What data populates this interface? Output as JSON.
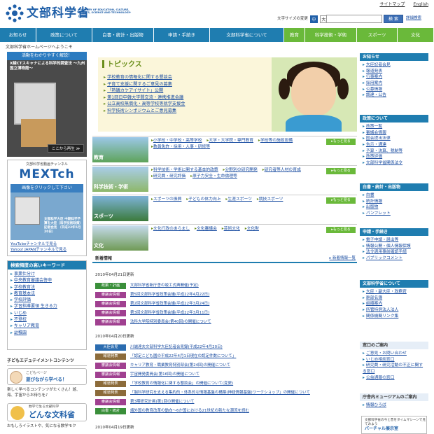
{
  "header": {
    "logo_text": "文部科学省",
    "logo_en": "MINISTRY OF EDUCATION, CULTURE, SPORTS, SCIENCE AND TECHNOLOGY-JAPAN",
    "top_links": [
      "サイトマップ",
      "English"
    ],
    "font_size_label": "文字サイズの変更",
    "font_size_options": [
      "中",
      "大"
    ],
    "search_placeholder": "",
    "search_button": "検 索",
    "advanced_search": "詳細検索"
  },
  "nav": {
    "items": [
      {
        "label": "お知らせ",
        "color": "#1f7db0"
      },
      {
        "label": "政策について",
        "color": "#1f7db0"
      },
      {
        "label": "白書・統計・出版物",
        "color": "#1f7db0"
      },
      {
        "label": "申請・手続き",
        "color": "#1f7db0"
      },
      {
        "label": "文部科学省について",
        "color": "#1f7db0"
      },
      {
        "label": "教育",
        "color": "#6ab93a"
      },
      {
        "label": "科学技術・学術",
        "color": "#6ab93a"
      },
      {
        "label": "スポーツ",
        "color": "#6ab93a"
      },
      {
        "label": "文化",
        "color": "#6ab93a"
      }
    ]
  },
  "breadcrumb": "文部科学省ホームページへようこそ",
  "banner1": {
    "caption": "活動をわかりやすく解説！",
    "title": "X線CTスキャナによる科学的調査法 〜九州国立博物館〜",
    "more": "ここから再生 ≫"
  },
  "mext": {
    "label": "文部科学省動画チャンネル",
    "logo": "MEXTch",
    "image_bar": "画像をクリックして下さい",
    "image_text": "文部科学大臣 中期科学予算を大臣（科学技術政策）記者会見 （平成22年5月20日）",
    "links": [
      "YouTubeチャンネルで見る",
      "Yahoo! JAPANチャンネルで見る"
    ]
  },
  "keywords": {
    "title": "検索頻度の高いキーワード",
    "items": [
      "事業仕分け",
      "中央教育審議会答申",
      "学校教育法",
      "教育基本法",
      "学校評価",
      "学習指導要領 生きる力",
      "いじめ",
      "不登校",
      "キャリア教育",
      "幼稚園"
    ]
  },
  "kids": {
    "title": "子どもエデュテイメントコンテンツ",
    "banner1_small": "こどもページ",
    "banner1_title": "遊びながら学べる！",
    "desc1": "楽しく学べるコンテンツがたくさん！遊、海、宇宙からお待ちを♪",
    "banner2_small": "数学で生る文部科学",
    "banner2_title": "どんな文科省",
    "desc2": "おもしろイラストや、気になる数学モク"
  },
  "topics": {
    "title": "トピックス",
    "items": [
      "学校教育の情報化に関する懇談会",
      "子育て支援に関するご意見の募集",
      "「熟議カケアイサイト」公開",
      "第1回日中韓大学間交流・連携推進会議",
      "公立高校無償化・高等学校等就学支援金",
      "科学技術シンポジウムとご意見募集"
    ]
  },
  "categories": [
    {
      "label": "教育",
      "items": [
        "小学校・中学校・高等学校",
        "大学・大学院・専門教育",
        "学校等の施設設備",
        "教員免許・採用・人事・研修等"
      ],
      "more": "▸もっと見る"
    },
    {
      "label": "科学技術・学術",
      "items": [
        "科学技術・学術に関する基本的政策",
        "分野別の研究開発",
        "研究者等人材の育成",
        "研究費・研究評価",
        "原子力安全・生命倫理等"
      ],
      "more": "▸もっと見る"
    },
    {
      "label": "スポーツ",
      "items": [
        "スポーツの振興",
        "子どもの体力向上",
        "生涯スポーツ",
        "競技スポーツ"
      ],
      "more": "▸もっと見る"
    },
    {
      "label": "文化",
      "items": [
        "文化行政のあらまし",
        "文化審議会",
        "芸術文化",
        "文化財"
      ],
      "more": "▸もっと見る"
    }
  ],
  "news": {
    "title": "新着情報",
    "rss": "▸ 新着情報一覧",
    "groups": [
      {
        "date": "2010年04月21日更新",
        "rows": [
          {
            "badge": "政策・計画",
            "color": "#3a8f3a",
            "text": "文部科学省新庁舎の竣工式典開催(予定)"
          },
          {
            "badge": "審議会情報",
            "color": "#a04090",
            "text": "第5回文部科学省政策会議(平成22年4月22日)"
          },
          {
            "badge": "審議会情報",
            "color": "#a04090",
            "text": "第2回文部科学省政策会議(平成22年3月24日)"
          },
          {
            "badge": "審議会情報",
            "color": "#a04090",
            "text": "第3回文部科学省政策会議(平成22年3月11日)"
          },
          {
            "badge": "審議会情報",
            "color": "#a04090",
            "text": "法科大学院特別委員会(第40回)の開催について"
          }
        ]
      },
      {
        "date": "2010年04月20日更新",
        "rows": [
          {
            "badge": "大臣会見",
            "color": "#2b6cb0",
            "text": "川端達夫文部科学大臣記者会見録(平成22年4月20日)"
          },
          {
            "badge": "報道発表",
            "color": "#8c6b3a",
            "text": "「認定こども園の平成22年4月1日現在の認定件数について」"
          },
          {
            "badge": "審議会情報",
            "color": "#a04090",
            "text": "キャリア教育・職業教育特別部会(第24回)の開催について"
          },
          {
            "badge": "審議会情報",
            "color": "#a04090",
            "text": "宇宙開発委員会(第16回)の開催について"
          },
          {
            "badge": "報道発表",
            "color": "#8c6b3a",
            "text": "「学校教育の情報化に関する懇談会」の開催について(変更)"
          },
          {
            "badge": "報道発表",
            "color": "#8c6b3a",
            "text": "「脳科学研究を支える集約的・体系的な情報基盤の構築(神経情報基盤)ワークショップ」の開催について"
          },
          {
            "badge": "審議会情報",
            "color": "#a04090",
            "text": "第3期研究計画(第1回の開催について"
          },
          {
            "badge": "白書・統計",
            "color": "#3a8f3a",
            "text": "諸外国の教育改革の動向〜6か国における21世紀の新たな潮流を読む"
          }
        ]
      },
      {
        "date": "2010年04月19日更新",
        "rows": []
      }
    ]
  },
  "right": {
    "oshirase": {
      "title": "お知らせ",
      "items": [
        "大臣記者会見",
        "報道発表",
        "行事案内",
        "採用案内",
        "公募情報",
        "調達・公告"
      ]
    },
    "seisaku": {
      "title": "政策について",
      "items": [
        "政策一覧",
        "審議会情報",
        "国会提出法律",
        "告示・通達",
        "予算・決算、税制等",
        "政策評価",
        "文部科学省関係法令"
      ]
    },
    "hakusho": {
      "title": "白書・統計・出版物",
      "items": [
        "白書",
        "統計情報",
        "出版物",
        "パンフレット"
      ]
    },
    "shinsei": {
      "title": "申請・手続き",
      "items": [
        "電子申請・届出等",
        "情報公開・個人情報保護",
        "法令適用事前確認手続",
        "パブリックコメント"
      ]
    },
    "about": {
      "title": "文部科学省について",
      "items": [
        "大臣・副大臣・政務官",
        "幹部名簿",
        "組織案内",
        "所管特例法人法人",
        "関係機関リンク集"
      ]
    },
    "madoguchi": {
      "title": "窓口のご案内",
      "items": [
        "ご意見・お問い合わせ",
        "いじめ相談窓口",
        "研究費・研究活動の不正に関する窓口",
        "公益通報の窓口"
      ]
    },
    "museum": {
      "title": "庁舎内ミュージアムのご案内",
      "items": [
        "情報ひろば"
      ]
    },
    "banner": {
      "small": "文部科学省の今と昔をタイムマシーンで見てみよう",
      "title": "バーチャル展示室"
    }
  }
}
